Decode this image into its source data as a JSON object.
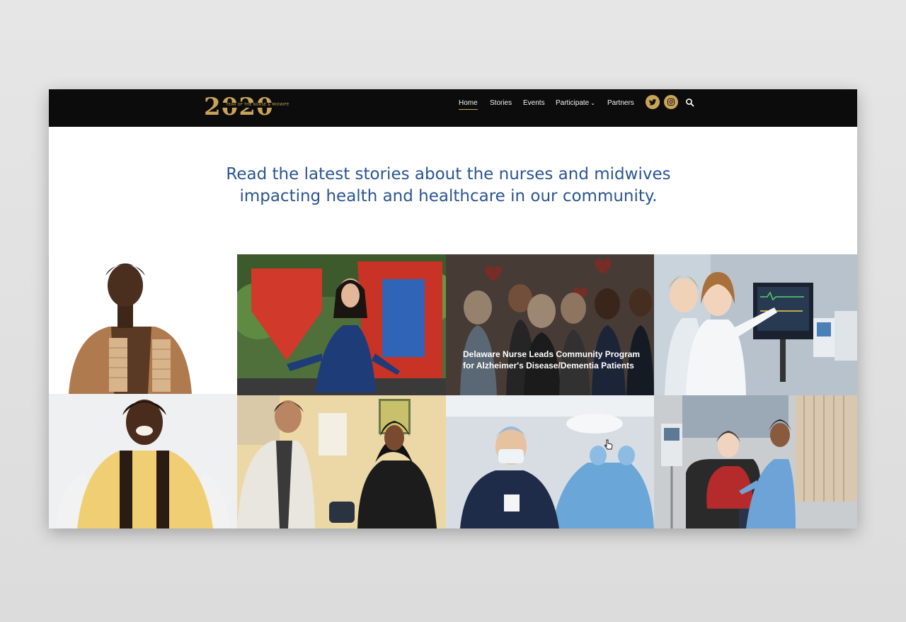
{
  "nav": {
    "logo_year": "2020",
    "logo_tagline": "YEAR OF THE NURSE & MIDWIFE",
    "items": [
      {
        "label": "Home",
        "active": true
      },
      {
        "label": "Stories",
        "active": false
      },
      {
        "label": "Events",
        "active": false
      },
      {
        "label": "Participate",
        "has_dropdown": true
      },
      {
        "label": "Partners",
        "active": false
      }
    ],
    "social": [
      "twitter-icon",
      "instagram-icon"
    ],
    "search": "search-icon"
  },
  "hero": {
    "headline_line1": "Read the latest stories about the nurses and midwives",
    "headline_line2": "impacting health and healthcare in our community."
  },
  "stories": {
    "featured_caption": "Delaware Nurse Leads Community Program for Alzheimer's Disease/Dementia Patients"
  },
  "colors": {
    "accent_gold": "#c8a45a",
    "nav_bg": "#0c0c0c",
    "headline_blue": "#2b5591"
  }
}
